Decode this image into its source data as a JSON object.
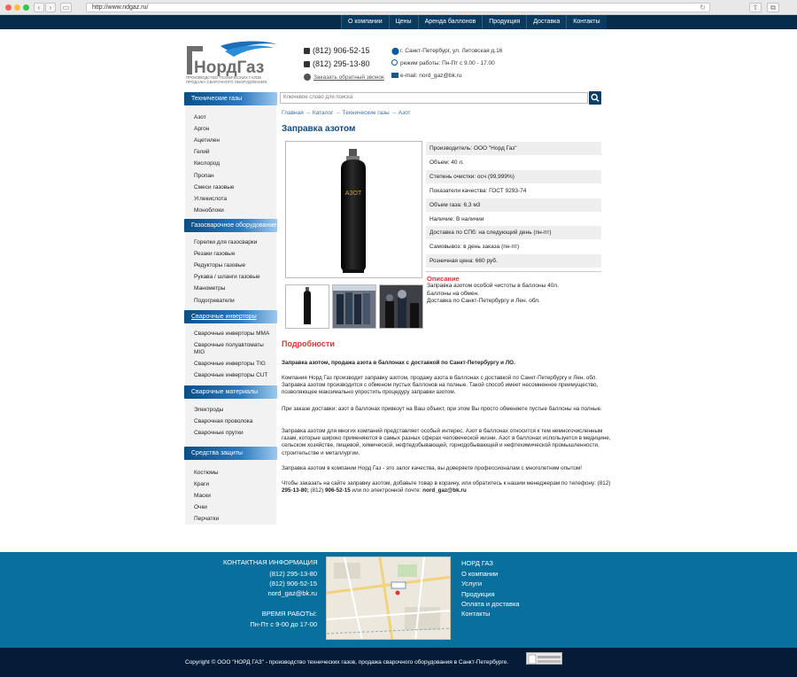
{
  "browser": {
    "url": "http://www.ndgaz.ru/"
  },
  "topnav": [
    "О компании",
    "Цены",
    "Аренда баллонов",
    "Продукция",
    "Доставка",
    "Контакты"
  ],
  "header": {
    "logo_text": "НордГаз",
    "logo_sub1": "ПРОИЗВОДСТВО ТЕХНИЧЕСКИХ ГАЗОВ",
    "logo_sub2": "ПРОДАЖА СВАРОЧНОГО ОБОРУДОВАНИЯ",
    "phone1": "(812) 906-52-15",
    "phone2": "(812) 295-13-80",
    "callback": "Заказать обратный звонок",
    "address": "г. Санкт-Петербург, ул. Литовская д.16",
    "hours": "режим работы: Пн-Пт с 9.00 - 17.00",
    "email": "e-mail: nord_gaz@bk.ru"
  },
  "sidebar": {
    "sections": [
      {
        "title": "Технические газы",
        "items": [
          "Азот",
          "Аргон",
          "Ацетилен",
          "Гелий",
          "Кислород",
          "Пропан",
          "Смеси газовые",
          "Углекислота",
          "Моноблоки"
        ]
      },
      {
        "title": "Газосварочное оборудование",
        "items": [
          "Горелки для газосварки",
          "Резаки газовые",
          "Редукторы газовые",
          "Рукава / шланги газовые",
          "Манометры",
          "Подогреватели"
        ]
      },
      {
        "title": "Сварочные инверторы",
        "items": [
          "Сварочные инверторы MMA",
          "Сварочные полуавтоматы MIG",
          "Сварочные инверторы TIG",
          "Сварочные инверторы CUT"
        ]
      },
      {
        "title": "Сварочные материалы",
        "items": [
          "Электроды",
          "Сварочная проволока",
          "Сварочные прутки"
        ]
      },
      {
        "title": "Средства защиты",
        "items": [
          "Костюмы",
          "Краги",
          "Маски",
          "Очки",
          "Перчатки"
        ]
      }
    ]
  },
  "search": {
    "placeholder": "Ключевое слово для поиска"
  },
  "breadcrumb": "Главная → Каталог → Технические газы → Азот",
  "product": {
    "title": "Заправка азотом",
    "cylinder_label": "АЗОТ",
    "props": [
      "Производитель: ООО \"Норд Газ\"",
      "Объем: 40 л.",
      "Степень очистки: осч (99,999%)",
      "Показатели качества: ГОСТ 9293-74",
      "Объем газа: 6,3 м3",
      "Наличие: В наличии",
      "Доставка по СПб: на следующий день (пн-пт)",
      "Самовывоз: в день заказа (пн-пт)",
      "Розничная цена: 660 руб."
    ],
    "desc_title": "Описание",
    "desc_lines": [
      "Заправка азотом особой чистоты в баллоны 40л.",
      "Баллоны на обмен.",
      "Доставка по Санкт-Петербургу и Лен. обл."
    ]
  },
  "details": {
    "title": "Подробности",
    "heading": "Заправка азотом, продажа азота в баллонах с доставкой по Санкт-Петербургу и ЛО.",
    "p1": "Компания Норд Газ производит заправку азотом, продажу азота в баллонах с доставкой по Санкт-Петербургу и Лен. обл.  Заправка азотом производится с обменом пустых баллонов на полные. Такой способ имеет несомненное преимущество, позволяющее  максимально упростить процедуру заправки азотом.",
    "p2": "При заказе доставки: азот в баллонах привезут на Ваш объект, при этом Вы просто обменяете пустые баллоны на полные.",
    "p3": "Заправка азотом для многих компаний представляет особый интерес. Азот в баллонах  относится к тем немногочисленным газам, которые широко применяются в самых разных сферах человеческой жизни. Азот в баллонах используется в медицине, сельском хозяйстве, пищевой, химической, нефтедобывающей, горнодобывающей и нефтехимической промышленности, строительстве и металлургии.",
    "p4": "Заправка азотом в компании Норд Газ - это залог качества, вы доверяете профессионалам с многолетним опытом!",
    "p5a": "Чтобы заказать на сайте заправку азотом, добавьте товар в корзину, или обратитесь к нашим менеджерам по телефону: (812) ",
    "p5b": "295-13-80;",
    "p5c": " (812) ",
    "p5d": "906-52-15",
    "p5e": " или по электронной почте: ",
    "p5f": "nord_gaz@bk.ru"
  },
  "footer": {
    "contact_title": "КОНТАКТНАЯ ИНФОРМАЦИЯ",
    "phone1": "(812) 295-13-80",
    "phone2": "(812) 906-52-15",
    "email": "nord_gaz@bk.ru",
    "hours_title": "ВРЕМЯ РАБОТЫ:",
    "hours": "Пн-Пт с 9-00 до 17-00",
    "links_title": "НОРД ГАЗ",
    "links": [
      "О компании",
      "Услуги",
      "Продукция",
      "Оплата и доставка",
      "Контакты"
    ],
    "copyright": "Copyright © ООО \"НОРД ГАЗ\" - производство технических газов, продажа сварочного оборудования в Санкт-Петербурге."
  }
}
